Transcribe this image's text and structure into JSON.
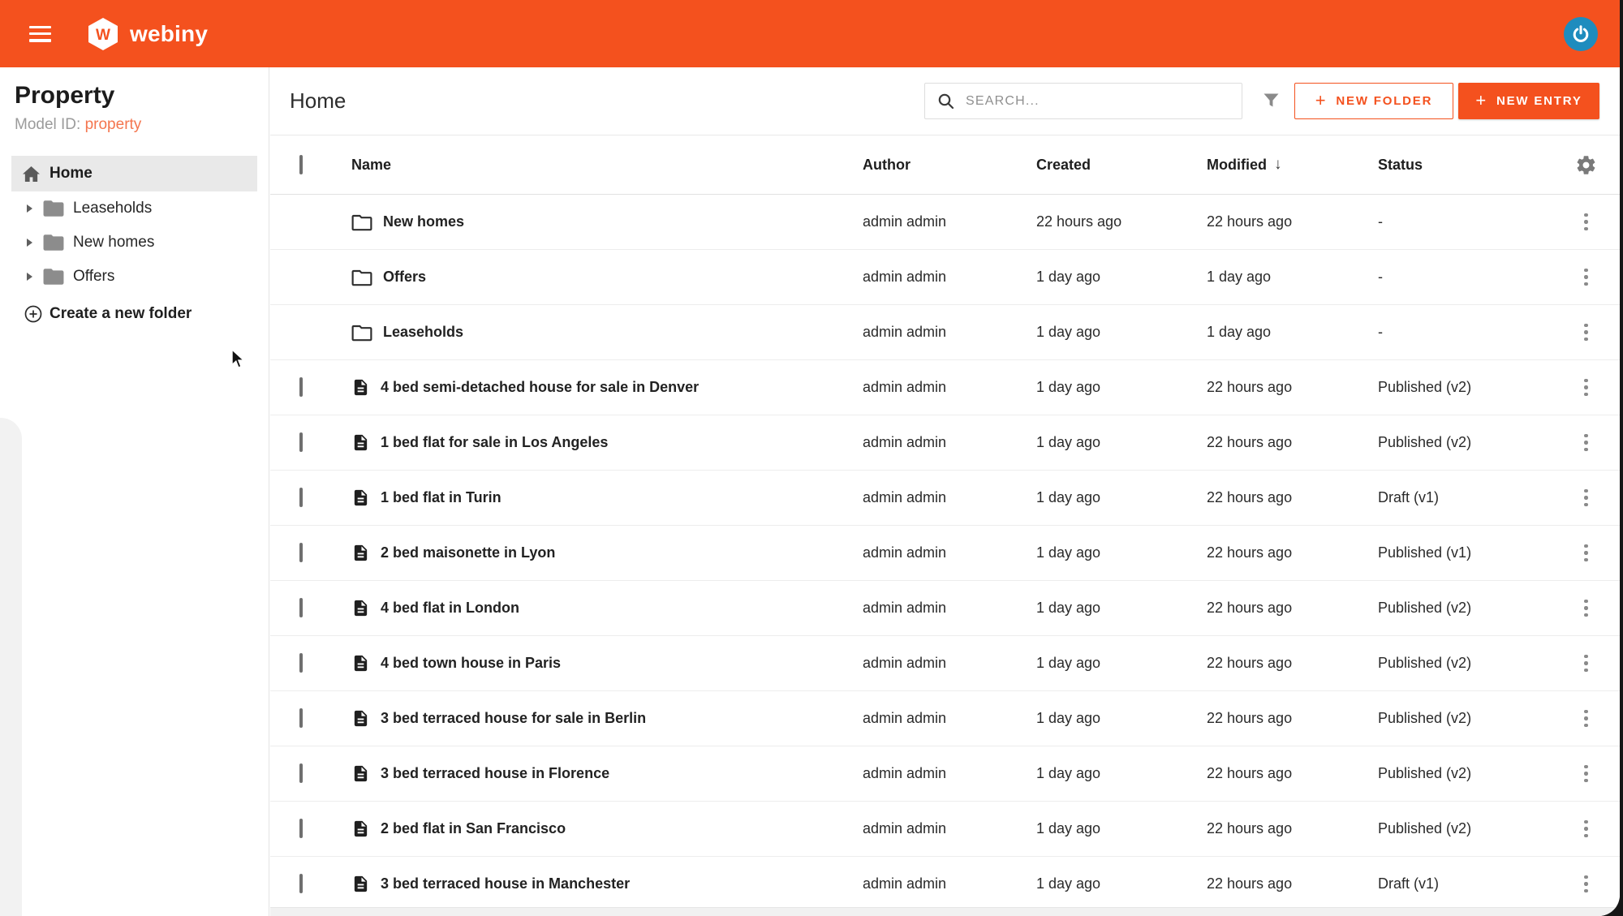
{
  "colors": {
    "accent": "#f4511e",
    "avatar_blue": "#1e8cbe",
    "property_link": "#f4764f",
    "selected_item_bg": "#e9e9e9"
  },
  "topbar": {
    "logo_text": "webiny",
    "logo_letter": "W"
  },
  "sidebar": {
    "title": "Property",
    "model_id_label": "Model ID:",
    "model_id_value": "property",
    "home_item": "Home",
    "folders": [
      "Leaseholds",
      "New homes",
      "Offers"
    ],
    "create_folder_label": "Create a new folder"
  },
  "header": {
    "title": "Home",
    "search_placeholder": "SEARCH...",
    "new_folder_label": "NEW FOLDER",
    "new_entry_label": "NEW ENTRY",
    "plus_glyph": "+"
  },
  "table": {
    "columns": {
      "name": "Name",
      "author": "Author",
      "created": "Created",
      "modified": "Modified",
      "status": "Status"
    },
    "sort_column": "Modified",
    "sort_arrow": "↓",
    "rows": [
      {
        "type": "folder",
        "name": "New homes",
        "author": "admin admin",
        "created": "22 hours ago",
        "modified": "22 hours ago",
        "status": "-"
      },
      {
        "type": "folder",
        "name": "Offers",
        "author": "admin admin",
        "created": "1 day ago",
        "modified": "1 day ago",
        "status": "-"
      },
      {
        "type": "folder",
        "name": "Leaseholds",
        "author": "admin admin",
        "created": "1 day ago",
        "modified": "1 day ago",
        "status": "-"
      },
      {
        "type": "entry",
        "name": "4 bed semi-detached house for sale in Denver",
        "author": "admin admin",
        "created": "1 day ago",
        "modified": "22 hours ago",
        "status": "Published (v2)"
      },
      {
        "type": "entry",
        "name": "1 bed flat for sale in Los Angeles",
        "author": "admin admin",
        "created": "1 day ago",
        "modified": "22 hours ago",
        "status": "Published (v2)"
      },
      {
        "type": "entry",
        "name": "1 bed flat in Turin",
        "author": "admin admin",
        "created": "1 day ago",
        "modified": "22 hours ago",
        "status": "Draft (v1)"
      },
      {
        "type": "entry",
        "name": "2 bed maisonette in Lyon",
        "author": "admin admin",
        "created": "1 day ago",
        "modified": "22 hours ago",
        "status": "Published (v1)"
      },
      {
        "type": "entry",
        "name": "4 bed flat in London",
        "author": "admin admin",
        "created": "1 day ago",
        "modified": "22 hours ago",
        "status": "Published (v2)"
      },
      {
        "type": "entry",
        "name": "4 bed town house in Paris",
        "author": "admin admin",
        "created": "1 day ago",
        "modified": "22 hours ago",
        "status": "Published (v2)"
      },
      {
        "type": "entry",
        "name": "3 bed terraced house for sale in Berlin",
        "author": "admin admin",
        "created": "1 day ago",
        "modified": "22 hours ago",
        "status": "Published (v2)"
      },
      {
        "type": "entry",
        "name": "3 bed terraced house in Florence",
        "author": "admin admin",
        "created": "1 day ago",
        "modified": "22 hours ago",
        "status": "Published (v2)"
      },
      {
        "type": "entry",
        "name": "2 bed flat in San Francisco",
        "author": "admin admin",
        "created": "1 day ago",
        "modified": "22 hours ago",
        "status": "Published (v2)"
      },
      {
        "type": "entry",
        "name": "3 bed terraced house in Manchester",
        "author": "admin admin",
        "created": "1 day ago",
        "modified": "22 hours ago",
        "status": "Draft (v1)"
      }
    ]
  }
}
